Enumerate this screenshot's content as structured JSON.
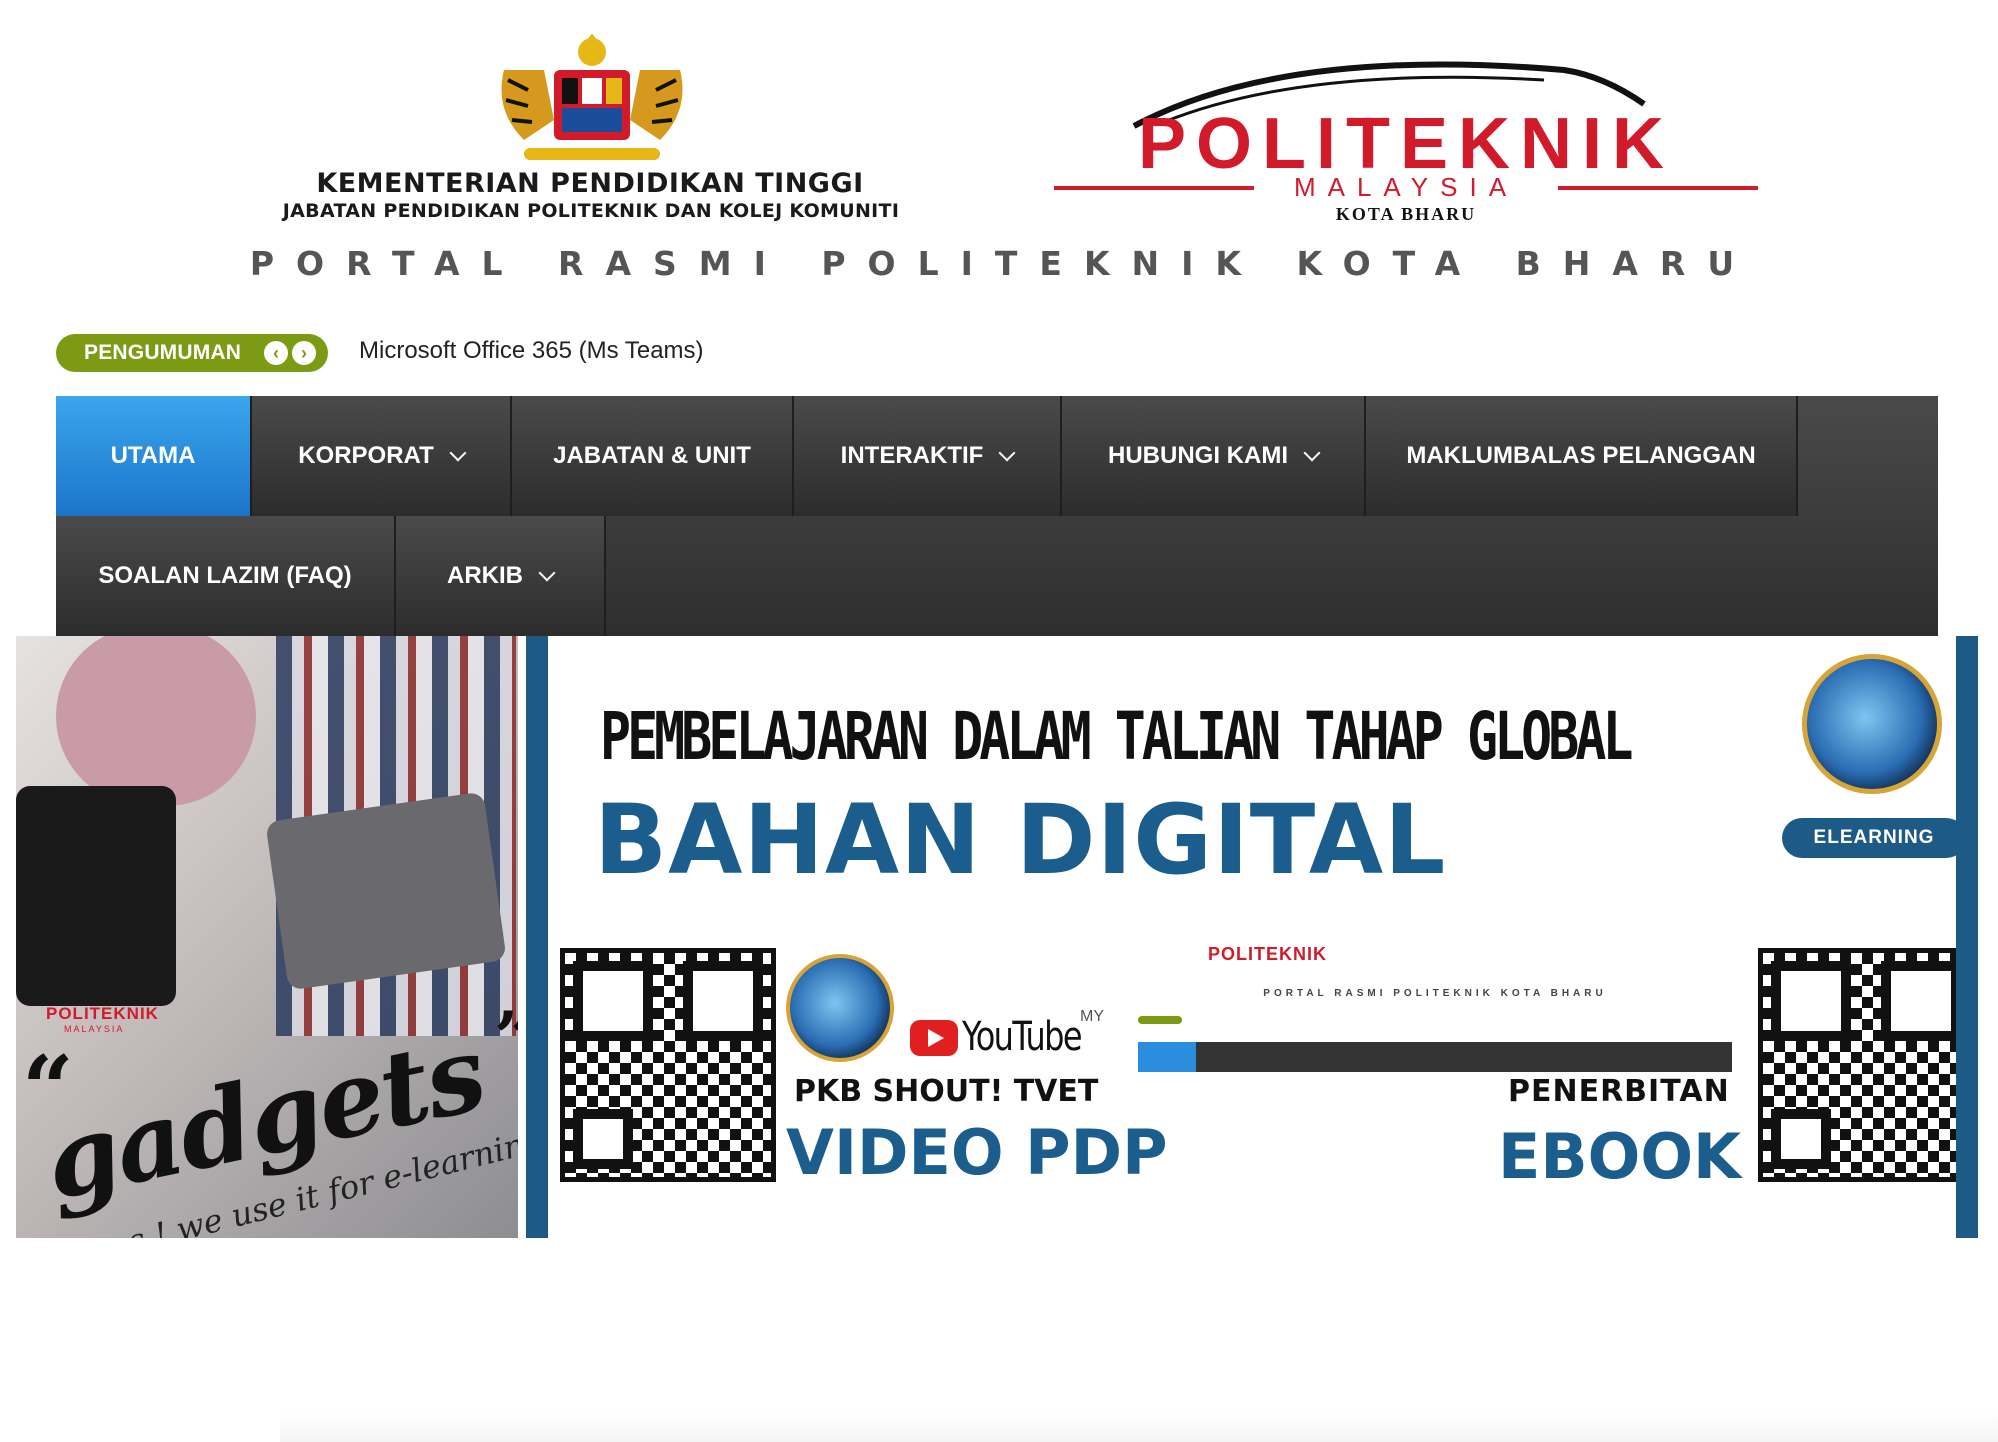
{
  "header": {
    "ministry_line1": "KEMENTERIAN PENDIDIKAN TINGGI",
    "ministry_line2": "JABATAN PENDIDIKAN POLITEKNIK DAN KOLEJ KOMUNITI",
    "logo_main": "POLITEKNIK",
    "logo_sub": "MALAYSIA",
    "logo_campus": "KOTA BHARU",
    "portal_title": "PORTAL RASMI POLITEKNIK KOTA BHARU"
  },
  "ticker": {
    "label": "PENGUMUMAN",
    "prev_icon": "chevron-left-icon",
    "next_icon": "chevron-right-icon",
    "text": "Microsoft Office 365 (Ms Teams)",
    "color": "#7c9a13"
  },
  "nav": {
    "items_row1": [
      {
        "label": "UTAMA",
        "has_dropdown": false,
        "active": true
      },
      {
        "label": "KORPORAT",
        "has_dropdown": true,
        "active": false
      },
      {
        "label": "JABATAN & UNIT",
        "has_dropdown": false,
        "active": false
      },
      {
        "label": "INTERAKTIF",
        "has_dropdown": true,
        "active": false
      },
      {
        "label": "HUBUNGI KAMI",
        "has_dropdown": true,
        "active": false
      },
      {
        "label": "MAKLUMBALAS PELANGGAN",
        "has_dropdown": false,
        "active": false
      }
    ],
    "items_row2": [
      {
        "label": "SOALAN LAZIM (FAQ)",
        "has_dropdown": false,
        "active": false
      },
      {
        "label": "ARKIB",
        "has_dropdown": true,
        "active": false
      }
    ],
    "active_color": "#2a8ddd",
    "bar_color": "#3a3a3a"
  },
  "banner": {
    "left": {
      "mini_logo": "POLITEKNIK",
      "mini_logo_sub": "MALAYSIA",
      "quote_open": "“",
      "quote_close": "”",
      "headline": "gadgets",
      "tagline": "yes ! we use it for e-learning"
    },
    "right": {
      "headline": "PEMBELAJARAN DALAM TALIAN TAHAP GLOBAL",
      "subheadline": "BAHAN DIGITAL",
      "elearning_button": "ELEARNING",
      "youtube_text": "YouTube",
      "youtube_region": "MY",
      "pkb_label": "PKB SHOUT! TVET",
      "video_label": "VIDEO PDP",
      "penerbitan_label": "PENERBITAN",
      "ebook_label": "EBOOK",
      "mini_site_title": "PORTAL RASMI POLITEKNIK KOTA BHARU",
      "accent_color": "#1b5e8e"
    }
  }
}
